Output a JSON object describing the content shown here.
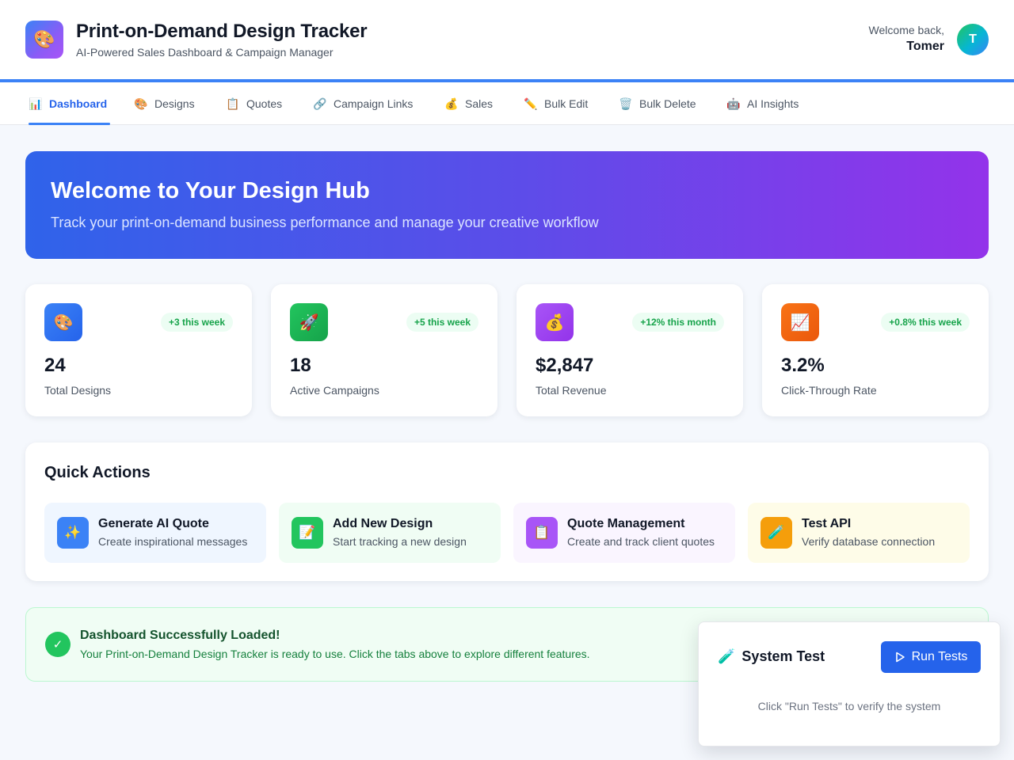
{
  "header": {
    "logo_icon": "🎨",
    "title": "Print-on-Demand Design Tracker",
    "subtitle": "AI-Powered Sales Dashboard & Campaign Manager",
    "welcome": "Welcome back,",
    "user_name": "Tomer",
    "avatar_initial": "T"
  },
  "nav": {
    "active": "Dashboard",
    "tabs": [
      {
        "icon": "📊",
        "label": "Dashboard"
      },
      {
        "icon": "🎨",
        "label": "Designs"
      },
      {
        "icon": "📋",
        "label": "Quotes"
      },
      {
        "icon": "🔗",
        "label": "Campaign Links"
      },
      {
        "icon": "💰",
        "label": "Sales"
      },
      {
        "icon": "✏️",
        "label": "Bulk Edit"
      },
      {
        "icon": "🗑️",
        "label": "Bulk Delete"
      },
      {
        "icon": "🤖",
        "label": "AI Insights"
      }
    ]
  },
  "banner": {
    "title": "Welcome to Your Design Hub",
    "text": "Track your print-on-demand business performance and manage your creative workflow"
  },
  "stats": [
    {
      "icon": "🎨",
      "color": "#3b82f6",
      "badge": "+3 this week",
      "value": "24",
      "label": "Total Designs"
    },
    {
      "icon": "🚀",
      "color": "#22c55e",
      "badge": "+5 this week",
      "value": "18",
      "label": "Active Campaigns"
    },
    {
      "icon": "💰",
      "color": "#a855f7",
      "badge": "+12% this month",
      "value": "$2,847",
      "label": "Total Revenue"
    },
    {
      "icon": "📈",
      "color": "#f97316",
      "badge": "+0.8% this week",
      "value": "3.2%",
      "label": "Click-Through Rate"
    }
  ],
  "quick_actions": {
    "title": "Quick Actions",
    "items": [
      {
        "icon": "✨",
        "color": "#3b82f6",
        "bg": "#eff6ff",
        "name": "Generate AI Quote",
        "desc": "Create inspirational messages"
      },
      {
        "icon": "📝",
        "color": "#22c55e",
        "bg": "#f0fdf4",
        "name": "Add New Design",
        "desc": "Start tracking a new design"
      },
      {
        "icon": "📋",
        "color": "#a855f7",
        "bg": "#faf5ff",
        "name": "Quote Management",
        "desc": "Create and track client quotes"
      },
      {
        "icon": "🧪",
        "color": "#f59e0b",
        "bg": "#fefce8",
        "name": "Test API",
        "desc": "Verify database connection"
      }
    ]
  },
  "alert": {
    "icon": "✓",
    "title": "Dashboard Successfully Loaded!",
    "text": "Your Print-on-Demand Design Tracker is ready to use. Click the tabs above to explore different features."
  },
  "system_test": {
    "icon": "🧪",
    "title": "System Test",
    "button_icon": "play-icon",
    "button_label": "Run Tests",
    "hint": "Click \"Run Tests\" to verify the system"
  },
  "colors": {
    "accent": "#2563eb",
    "success": "#22c55e",
    "banner_start": "#2f63ea",
    "banner_end": "#9333ea"
  }
}
